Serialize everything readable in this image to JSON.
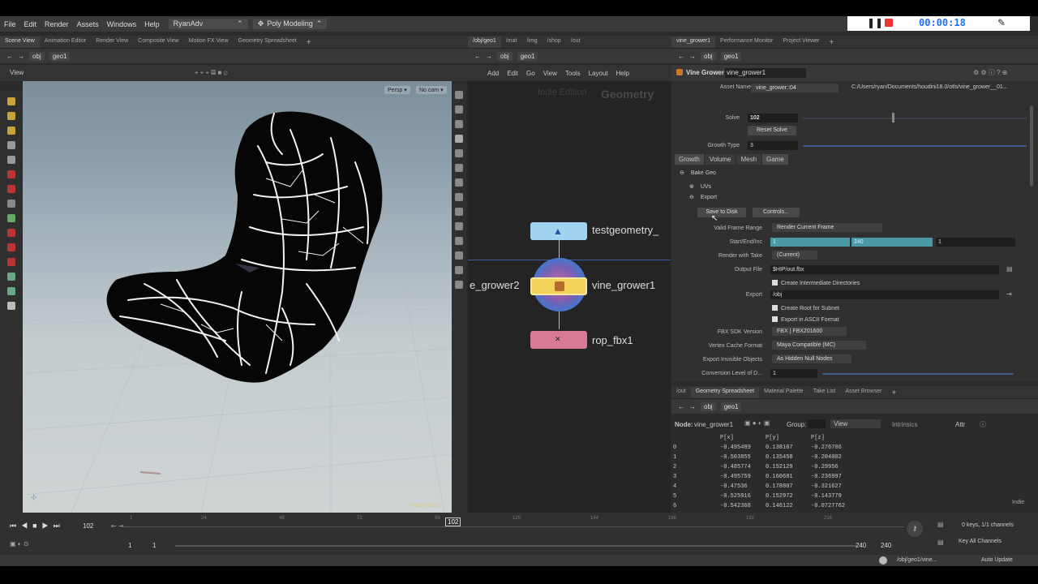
{
  "menu": {
    "items": [
      "File",
      "Edit",
      "Render",
      "Assets",
      "Windows",
      "Help"
    ],
    "desktop": "RyanAdv",
    "toolbar_mode": "Poly Modeling"
  },
  "recorder": {
    "time": "00:00:18"
  },
  "left_tabs": [
    "Scene View",
    "Animation Editor",
    "Render View",
    "Composite View",
    "Motion FX View",
    "Geometry Spreadsheet"
  ],
  "mid_tabs": [
    "/obj/geo1",
    "/mat",
    "/img",
    "/shop",
    "/out"
  ],
  "right_tabs": [
    "vine_grower1",
    "Performance Monitor",
    "Project Viewer"
  ],
  "path": {
    "obj": "obj",
    "geo": "geo1"
  },
  "viewport": {
    "title": "View",
    "persp": "Persp",
    "cam": "No cam",
    "watermark": "Indie Edition"
  },
  "network": {
    "menu": [
      "Add",
      "Edit",
      "Go",
      "View",
      "Tools",
      "Layout",
      "Help"
    ],
    "edition": "Indie Edition",
    "context": "Geometry",
    "nodes": {
      "top": "testgeometry_",
      "mid_left": "e_grower2",
      "mid": "vine_grower1",
      "bottom": "rop_fbx1"
    }
  },
  "params": {
    "type": "Vine Grower",
    "name": "vine_grower1",
    "asset_label": "Asset Name and Path",
    "asset": "vine_grower::04",
    "asset_path": "C:/Users/ryan/Documents/houdini18.0/otls/vine_grower__01...",
    "solve_label": "Solve",
    "solve": "102",
    "reset": "Reset Solve",
    "growth_type_label": "Growth Type",
    "growth_type": "3",
    "tabs": [
      "Growth",
      "Volume",
      "Mesh",
      "Game"
    ],
    "bake": "Bake Geo",
    "uvs": "UVs",
    "export": "Export",
    "save": "Save to Disk",
    "controls": "Controls...",
    "valid_label": "Valid Frame Range",
    "valid": "Render Current Frame",
    "sei_label": "Start/End/Inc",
    "start": "1",
    "end": "240",
    "inc": "1",
    "take_label": "Render with Take",
    "take": "(Current)",
    "out_label": "Output File",
    "out": "$HIP/out.fbx",
    "create_dirs": "Create Intermediate Directories",
    "export_label": "Export",
    "export_path": "/obj",
    "root": "Create Root for Subnet",
    "ascii": "Export in ASCII Format",
    "fbx_label": "FBX SDK Version",
    "fbx": "FBX | FBX201600",
    "vcf_label": "Vertex Cache Format",
    "vcf": "Maya Compatible (MC)",
    "invis_label": "Export Invisible Objects",
    "invis": "As Hidden Null Nodes",
    "conv_label": "Conversion Level of D...",
    "conv": "1"
  },
  "sheet": {
    "tabs": [
      "/out",
      "Geometry Spreadsheet",
      "Material Palette",
      "Take List",
      "Asset Browser"
    ],
    "node_label": "Node:",
    "node": "vine_grower1",
    "group": "Group:",
    "view": "View",
    "intrinsics": "Intrinsics",
    "attr": "Attr",
    "headers": [
      "",
      "P[x]",
      "P[y]",
      "P[z]"
    ],
    "rows": [
      [
        "0",
        "-0.495489",
        "0.138107",
        "-0.276706"
      ],
      [
        "1",
        "-0.503855",
        "0.135458",
        "-0.204002"
      ],
      [
        "2",
        "-0.485774",
        "0.152129",
        "-0.29956"
      ],
      [
        "3",
        "-0.495759",
        "0.160681",
        "-0.236997"
      ],
      [
        "4",
        "-0.47536",
        "0.178807",
        "-0.321627"
      ],
      [
        "5",
        "-0.525916",
        "0.152972",
        "-0.143779"
      ],
      [
        "6",
        "-0.542368",
        "0.146122",
        "-0.0727762"
      ]
    ],
    "indie": "Indie"
  },
  "timeline": {
    "frame": "102",
    "marker": "102",
    "ticks": [
      "1",
      "24",
      "48",
      "72",
      "96",
      "120",
      "144",
      "168",
      "192",
      "216"
    ],
    "start": "1",
    "start2": "1",
    "end": "240",
    "end2": "240",
    "keys": "0 keys, 1/1 channels",
    "key_all": "Key All Channels"
  },
  "status": {
    "path": "/obj/geo1/vine...",
    "update": "Auto Update"
  }
}
